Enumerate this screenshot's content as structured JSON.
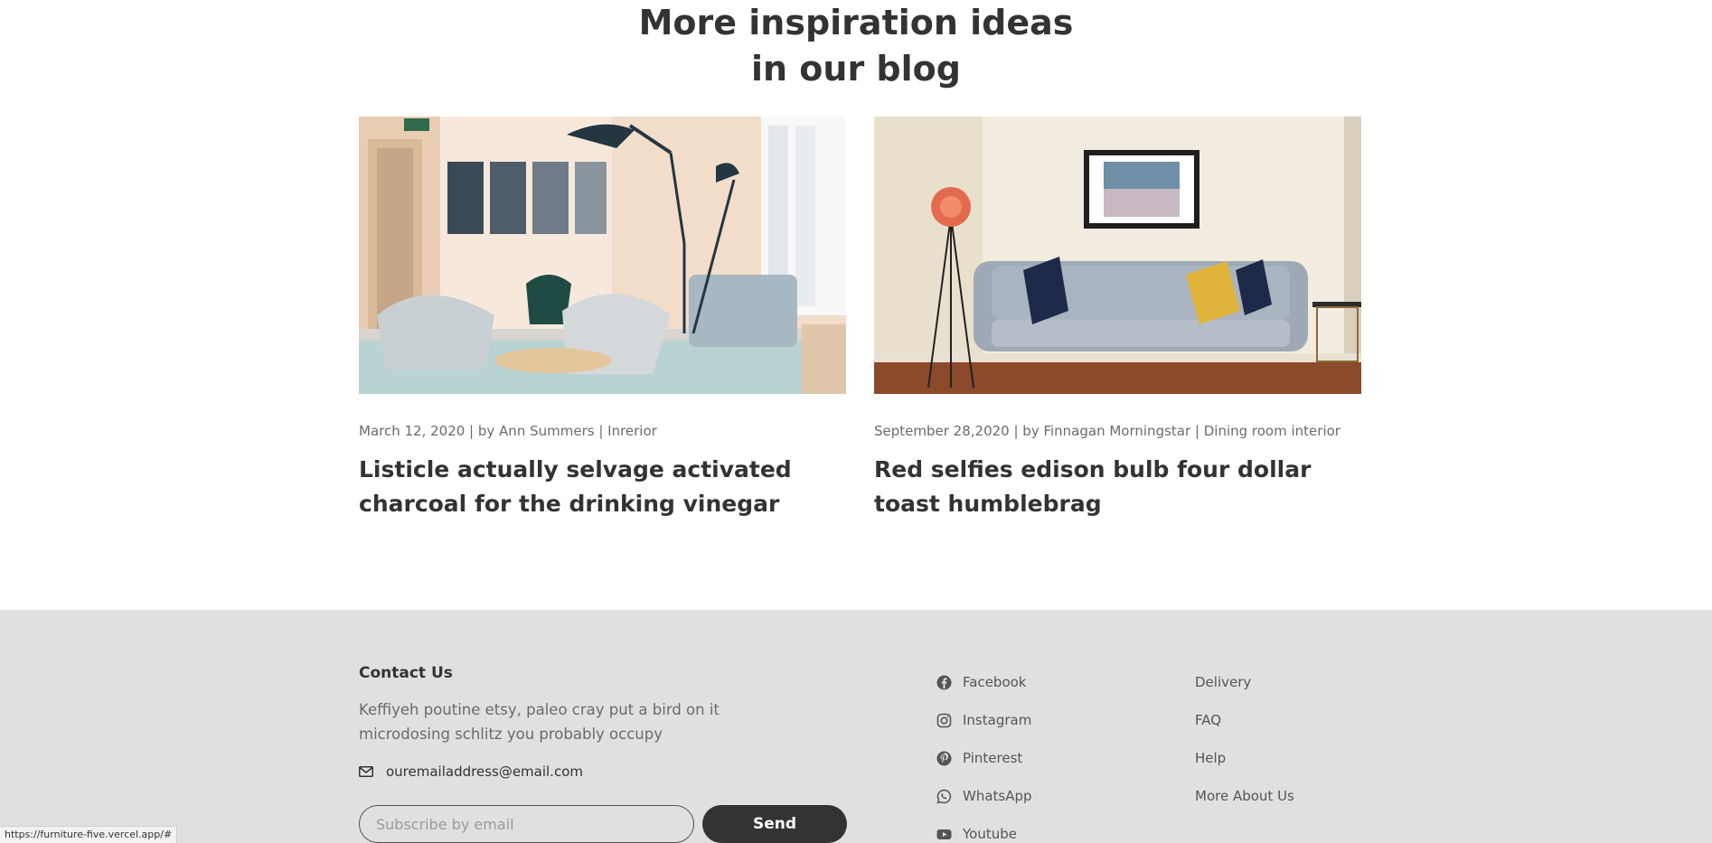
{
  "blog": {
    "heading_line1": "More inspiration ideas",
    "heading_line2": "in our blog",
    "posts": [
      {
        "meta": "March 12, 2020 | by Ann Summers | Inrerior",
        "title": "Listicle actually selvage activated charcoal for the drinking vinegar",
        "image": "office-lounge-chairs-photo"
      },
      {
        "meta": "September 28,2020 | by Finnagan Morningstar | Dining room interior",
        "title": "Red selfies edison bulb four dollar toast humblebrag",
        "image": "living-room-sofa-photo"
      }
    ]
  },
  "footer": {
    "contact_title": "Contact Us",
    "contact_desc": "Keffiyeh poutine etsy, paleo cray put a bird on it microdosing schlitz you probably occupy",
    "email": "ouremailaddress@email.com",
    "subscribe_placeholder": "Subscribe by email",
    "send_label": "Send",
    "social": [
      {
        "label": "Facebook",
        "icon": "facebook-icon"
      },
      {
        "label": "Instagram",
        "icon": "instagram-icon"
      },
      {
        "label": "Pinterest",
        "icon": "pinterest-icon"
      },
      {
        "label": "WhatsApp",
        "icon": "whatsapp-icon"
      },
      {
        "label": "Youtube",
        "icon": "youtube-icon"
      }
    ],
    "links": [
      "Delivery",
      "FAQ",
      "Help",
      "More About Us"
    ]
  },
  "status_bar": {
    "url": "https://furniture-five.vercel.app/#"
  }
}
